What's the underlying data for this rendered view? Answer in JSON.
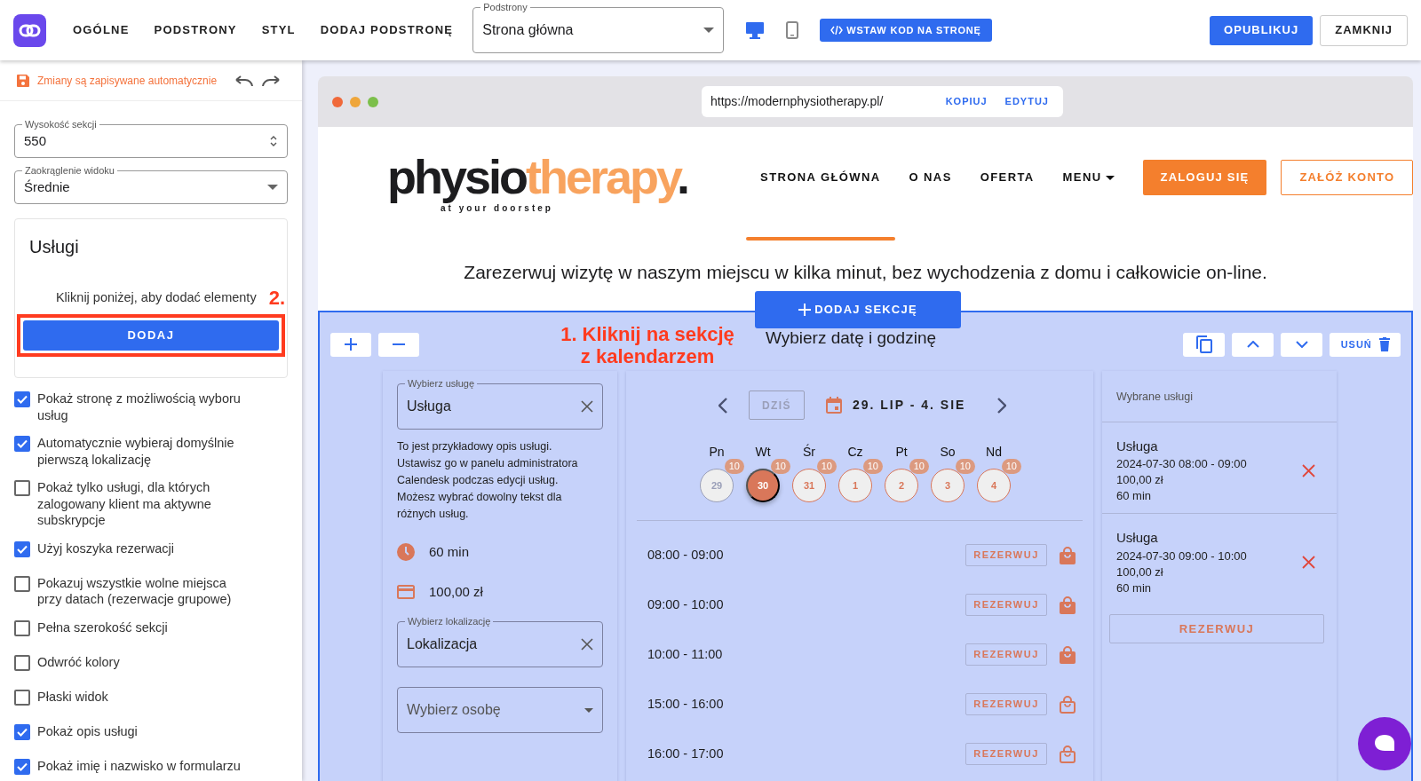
{
  "topbar": {
    "menu": [
      "OGÓLNE",
      "PODSTRONY",
      "STYL",
      "DODAJ PODSTRONĘ"
    ],
    "page_select": {
      "label": "Podstrony",
      "value": "Strona główna"
    },
    "devices": [
      {
        "kind": "desktop",
        "selected": true
      },
      {
        "kind": "mobile",
        "selected": false
      }
    ],
    "embed_button": "WSTAW KOD NA STRONĘ",
    "publish_button": "OPUBLIKUJ",
    "close_button": "ZAMKNIJ"
  },
  "sidebar": {
    "autosave": "Zmiany są zapisywane automatycznie",
    "fields": [
      {
        "kind": "number",
        "label": "Wysokość sekcji",
        "value": "550"
      },
      {
        "kind": "select",
        "label": "Zaokrąglenie widoku",
        "value": "Średnie"
      }
    ],
    "services_card": {
      "title": "Usługi",
      "hint": "Kliknij poniżej, aby dodać elementy",
      "button": "DODAJ",
      "step_label": "2."
    },
    "options": [
      {
        "label": "Pokaż stronę z możliwością wyboru usług",
        "checked": true
      },
      {
        "label": "Automatycznie wybieraj domyślnie pierwszą lokalizację",
        "checked": true
      },
      {
        "label": "Pokaż tylko usługi, dla których zalogowany klient ma aktywne subskrypcje",
        "checked": false
      },
      {
        "label": "Użyj koszyka rezerwacji",
        "checked": true
      },
      {
        "label": "Pokazuj wszystkie wolne miejsca przy datach (rezerwacje grupowe)",
        "checked": false
      },
      {
        "label": "Pełna szerokość sekcji",
        "checked": false
      },
      {
        "label": "Odwróć kolory",
        "checked": false
      },
      {
        "label": "Płaski widok",
        "checked": false
      },
      {
        "label": "Pokaż opis usługi",
        "checked": true
      },
      {
        "label": "Pokaż imię i nazwisko w formularzu",
        "checked": true
      }
    ]
  },
  "preview": {
    "url": "https://modernphysiotherapy.pl/",
    "url_actions": [
      "KOPIUJ",
      "EDYTUJ"
    ],
    "logo": {
      "dark_part": "physio",
      "accent_part": "therapy",
      "dot": ".",
      "tagline": "at your doorstep"
    },
    "nav": [
      {
        "kind": "link",
        "label": "STRONA GŁÓWNA",
        "selected": true
      },
      {
        "kind": "link",
        "label": "O NAS",
        "selected": false
      },
      {
        "kind": "link",
        "label": "OFERTA",
        "selected": false
      },
      {
        "kind": "dropdown",
        "label": "MENU",
        "selected": false
      }
    ],
    "login_button": "ZALOGUJ SIĘ",
    "register_button": "ZAŁÓŻ KONTO",
    "headline": "Zarezerwuj wizytę w naszym miejscu w kilka minut, bez wychodzenia z domu i całkowicie on-line.",
    "add_section_button": "DODAJ SEKCJĘ",
    "section": {
      "title": "Wybierz datę i godzinę",
      "delete_button": "USUŃ",
      "step_label": "1. Kliknij na sekcję z kalendarzem",
      "service_field": {
        "label": "Wybierz usługę",
        "value": "Usługa"
      },
      "description": "To jest przykładowy opis usługi. Ustawisz go w panelu administratora Calendesk podczas edycji usług. Możesz wybrać dowolny tekst dla różnych usług.",
      "duration": "60 min",
      "price": "100,00 zł",
      "location_field": {
        "label": "Wybierz lokalizację",
        "value": "Lokalizacja"
      },
      "person_field": {
        "placeholder": "Wybierz osobę"
      },
      "calendar": {
        "today_button": "DZIŚ",
        "range": "29. LIP - 4. SIE",
        "days": [
          {
            "weekday": "Pn",
            "date": "29",
            "count": "10",
            "selected": false,
            "disabled": true
          },
          {
            "weekday": "Wt",
            "date": "30",
            "count": "10",
            "selected": true,
            "disabled": false
          },
          {
            "weekday": "Śr",
            "date": "31",
            "count": "10",
            "selected": false,
            "disabled": false
          },
          {
            "weekday": "Cz",
            "date": "1",
            "count": "10",
            "selected": false,
            "disabled": false
          },
          {
            "weekday": "Pt",
            "date": "2",
            "count": "10",
            "selected": false,
            "disabled": false
          },
          {
            "weekday": "So",
            "date": "3",
            "count": "10",
            "selected": false,
            "disabled": false
          },
          {
            "weekday": "Nd",
            "date": "4",
            "count": "10",
            "selected": false,
            "disabled": false
          }
        ],
        "slots": [
          {
            "time": "08:00 - 09:00",
            "button": "REZERWUJ",
            "in_cart": true
          },
          {
            "time": "09:00 - 10:00",
            "button": "REZERWUJ",
            "in_cart": true
          },
          {
            "time": "10:00 - 11:00",
            "button": "REZERWUJ",
            "in_cart": true
          },
          {
            "time": "15:00 - 16:00",
            "button": "REZERWUJ",
            "in_cart": false
          },
          {
            "time": "16:00 - 17:00",
            "button": "REZERWUJ",
            "in_cart": false
          }
        ]
      },
      "cart": {
        "title": "Wybrane usługi",
        "items": [
          {
            "name": "Usługa",
            "date": "2024-07-30 08:00 - 09:00",
            "price": "100,00 zł",
            "duration": "60 min"
          },
          {
            "name": "Usługa",
            "date": "2024-07-30 09:00 - 10:00",
            "price": "100,00 zł",
            "duration": "60 min"
          }
        ],
        "button": "REZERWUJ"
      }
    }
  }
}
